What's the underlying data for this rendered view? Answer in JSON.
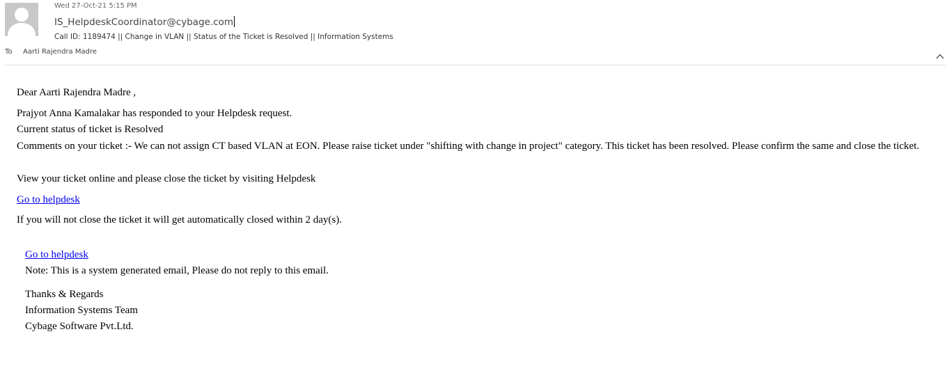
{
  "header": {
    "date": "Wed 27-Oct-21 5:15 PM",
    "sender": "IS_HelpdeskCoordinator@cybage.com",
    "subject": "Call ID: 1189474 || Change in VLAN || Status of the Ticket is Resolved || Information Systems",
    "to_label": "To",
    "to_value": "Aarti Rajendra Madre",
    "avatar_icon": "person-silhouette-icon",
    "collapse_icon": "chevron-up-icon"
  },
  "body": {
    "greeting": "Dear Aarti Rajendra Madre ,",
    "responded": "Prajyot Anna Kamalakar has responded to your Helpdesk request.",
    "status": "Current status of ticket is Resolved",
    "comments": "Comments on your ticket :- We can not assign CT based VLAN at EON. Please raise ticket under \"shifting with change in project\" category. This ticket has been resolved. Please confirm the same and close the ticket.",
    "view_online": "View your ticket online and please close the ticket by visiting Helpdesk",
    "link1": "Go to helpdesk",
    "auto_close": "If you will not close the ticket it will get automatically closed within 2 day(s).",
    "link2": "Go to helpdesk",
    "note": "Note: This is a system generated email, Please do not reply to this email.",
    "thanks": "Thanks & Regards",
    "team": "Information Systems Team",
    "company": "Cybage Software Pvt.Ltd."
  },
  "colors": {
    "link": "#0000ee",
    "avatar_bg": "#c8c8c8",
    "divider": "#e1e1e1"
  }
}
